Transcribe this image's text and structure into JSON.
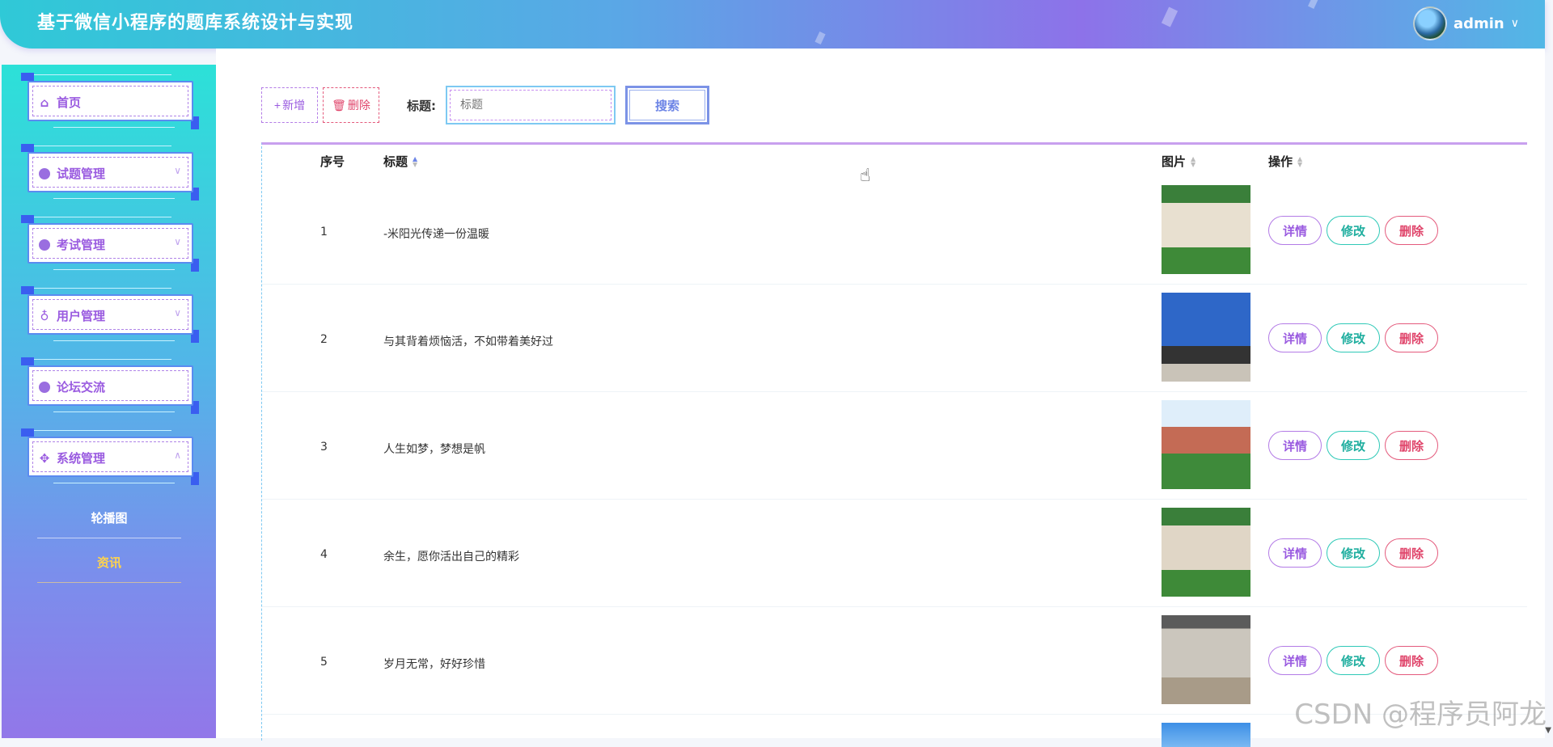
{
  "header": {
    "title": "基于微信小程序的题库系统设计与实现",
    "user_name": "admin"
  },
  "sidebar": {
    "items": [
      {
        "label": "首页",
        "icon": "home-icon"
      },
      {
        "label": "试题管理",
        "icon": "dot-circle-icon",
        "expanded": false
      },
      {
        "label": "考试管理",
        "icon": "dot-circle-icon",
        "expanded": false
      },
      {
        "label": "用户管理",
        "icon": "user-badge-icon",
        "expanded": false
      },
      {
        "label": "论坛交流",
        "icon": "dot-circle-icon"
      },
      {
        "label": "系统管理",
        "icon": "grid-icon",
        "expanded": true
      }
    ],
    "submenu": [
      {
        "label": "轮播图",
        "active": false
      },
      {
        "label": "资讯",
        "active": true
      }
    ]
  },
  "toolbar": {
    "add_label": "新增",
    "delete_label": "删除",
    "title_label": "标题:",
    "search_placeholder": "标题",
    "search_label": "搜索"
  },
  "table": {
    "columns": [
      "序号",
      "标题",
      "图片",
      "操作"
    ],
    "rows": [
      {
        "no": "1",
        "title": "-米阳光传递一份温暖"
      },
      {
        "no": "2",
        "title": "与其背着烦恼活，不如带着美好过"
      },
      {
        "no": "3",
        "title": "人生如梦，梦想是帆"
      },
      {
        "no": "4",
        "title": "余生，愿你活出自己的精彩"
      },
      {
        "no": "5",
        "title": "岁月无常，好好珍惜"
      }
    ],
    "actions": {
      "detail": "详情",
      "edit": "修改",
      "remove": "删除"
    }
  },
  "watermark": "CSDN @程序员阿龙",
  "colors": {
    "accent_purple": "#9a5be0",
    "accent_teal": "#1fae9f",
    "accent_red": "#e0456b",
    "accent_blue": "#6d85e6"
  }
}
